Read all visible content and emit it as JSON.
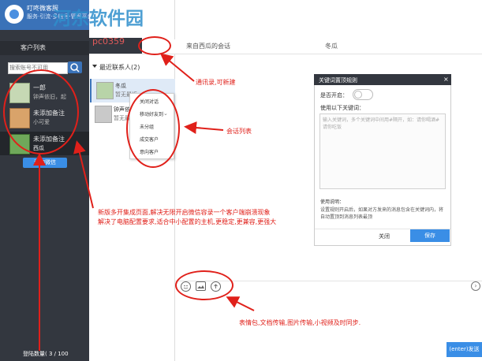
{
  "app": {
    "title": "叮咚微客服",
    "subtitle": "服务·引流·多帐号·管理平台"
  },
  "watermark": {
    "text": "河东软件园",
    "url": "pc0359"
  },
  "account_bar": {
    "name": "客户列表"
  },
  "search": {
    "placeholder": "搜索账号不可用"
  },
  "accounts": [
    {
      "name": "一郎",
      "sub": "钟声依旧，起"
    },
    {
      "name": "未添加备注",
      "sub": "小可爱"
    },
    {
      "name": "未添加备注",
      "sub": "西瓜"
    }
  ],
  "add_wechat": "添加微信",
  "login_count": "登陆数量( 3 / 100",
  "tabs": {
    "contacts": "通讯录",
    "chat_title": "来自西瓜的会话",
    "partner": "冬瓜"
  },
  "recent_header": "最近联系人(2)",
  "contacts": [
    {
      "name": "冬瓜",
      "sub": "暂无最近"
    },
    {
      "name": "钟声依旧",
      "sub": "暂无最近"
    }
  ],
  "context_menu": [
    "关闭对话",
    "移动好友到",
    "未分组",
    "成交客户",
    "意向客户"
  ],
  "keyword_dialog": {
    "title": "关键词置顶规则",
    "enable_label": "是否开启：",
    "reply_label": "使用以下关键词：",
    "placeholder": "输入关键词，多个关键词中间用#隔开，如：请你喝酒#请你吃饭",
    "help_title": "使用说明：",
    "help_body": "设置规则开启后，如果对方发来的消息包含在关键词内，将自动置顶到消息列表最顶",
    "cancel": "关闭",
    "save": "保存"
  },
  "send_button": "(enter)发送",
  "annotations": {
    "contacts_note": "通讯录,可新建",
    "session_note": "会话列表",
    "main_note_1": "新版多开集成页面,解决无限开启微信容录一个客户端崩溃现象",
    "main_note_2": "解决了电脑配置要求,适合中小配置的主机,更稳定,更兼容,更强大",
    "toolbar_note": "表情包,文档传输,图片传输,小视频及时同步."
  },
  "colors": {
    "sidebar": "#33373f",
    "accent": "#3a8ee6",
    "annotation": "#e0201a"
  },
  "icons": [
    "emoji-icon",
    "image-icon",
    "upload-icon",
    "chevron-right-icon"
  ]
}
